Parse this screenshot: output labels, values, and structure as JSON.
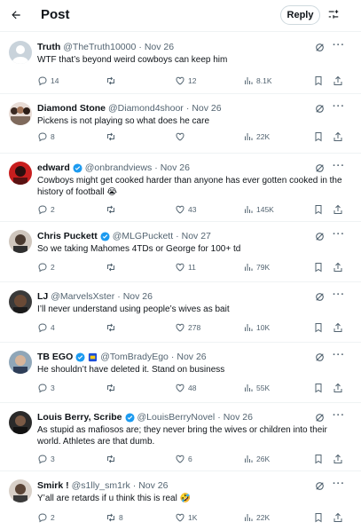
{
  "header": {
    "title": "Post",
    "reply_label": "Reply",
    "back_icon": "arrow-left-icon",
    "tune_icon": "sliders-icon"
  },
  "colors": {
    "verified": "#1d9bf0",
    "secondary_text": "#536471",
    "border": "#eff3f4"
  },
  "tweets": [
    {
      "name": "Truth",
      "handle": "@TheTruth10000",
      "date": "Nov 26",
      "verified": false,
      "text": "WTF that’s beyond weird cowboys can keep him",
      "replies": "14",
      "retweets": "",
      "likes": "12",
      "views": "8.1K"
    },
    {
      "name": "Diamond Stone",
      "handle": "@Diamond4shoor",
      "date": "Nov 26",
      "verified": false,
      "text": "Pickens is not playing so what does he care",
      "replies": "8",
      "retweets": "",
      "likes": "",
      "views": "22K"
    },
    {
      "name": "edward",
      "handle": "@onbrandviews",
      "date": "Nov 26",
      "verified": true,
      "text": "Cowboys might get cooked harder than anyone has ever gotten cooked in the history of football 😭",
      "replies": "2",
      "retweets": "",
      "likes": "43",
      "views": "145K"
    },
    {
      "name": "Chris Puckett",
      "handle": "@MLGPuckett",
      "date": "Nov 27",
      "verified": true,
      "text": "So we taking Mahomes 4TDs or George for 100+ td",
      "replies": "2",
      "retweets": "",
      "likes": "11",
      "views": "79K"
    },
    {
      "name": "LJ",
      "handle": "@MarvelsXster",
      "date": "Nov 26",
      "verified": false,
      "text": "I’ll never understand using people’s wives as bait",
      "replies": "4",
      "retweets": "",
      "likes": "278",
      "views": "10K"
    },
    {
      "name": "TB EGO",
      "handle": "@TomBradyEgo",
      "date": "Nov 26",
      "verified": true,
      "text": "He shouldn’t have deleted it. Stand on business",
      "replies": "3",
      "retweets": "",
      "likes": "48",
      "views": "55K"
    },
    {
      "name": "Louis Berry, Scribe",
      "handle": "@LouisBerryNovel",
      "date": "Nov 26",
      "verified": true,
      "text": "As stupid as mafiosos are; they never bring the wives or children into their world. Athletes are that dumb.",
      "replies": "3",
      "retweets": "",
      "likes": "6",
      "views": "26K"
    },
    {
      "name": "Smirk !",
      "handle": "@s1lly_sm1rk",
      "date": "Nov 26",
      "verified": false,
      "text": "Y’all are retards if u think this is real 🤣",
      "replies": "2",
      "retweets": "8",
      "likes": "1K",
      "views": "22K"
    }
  ]
}
